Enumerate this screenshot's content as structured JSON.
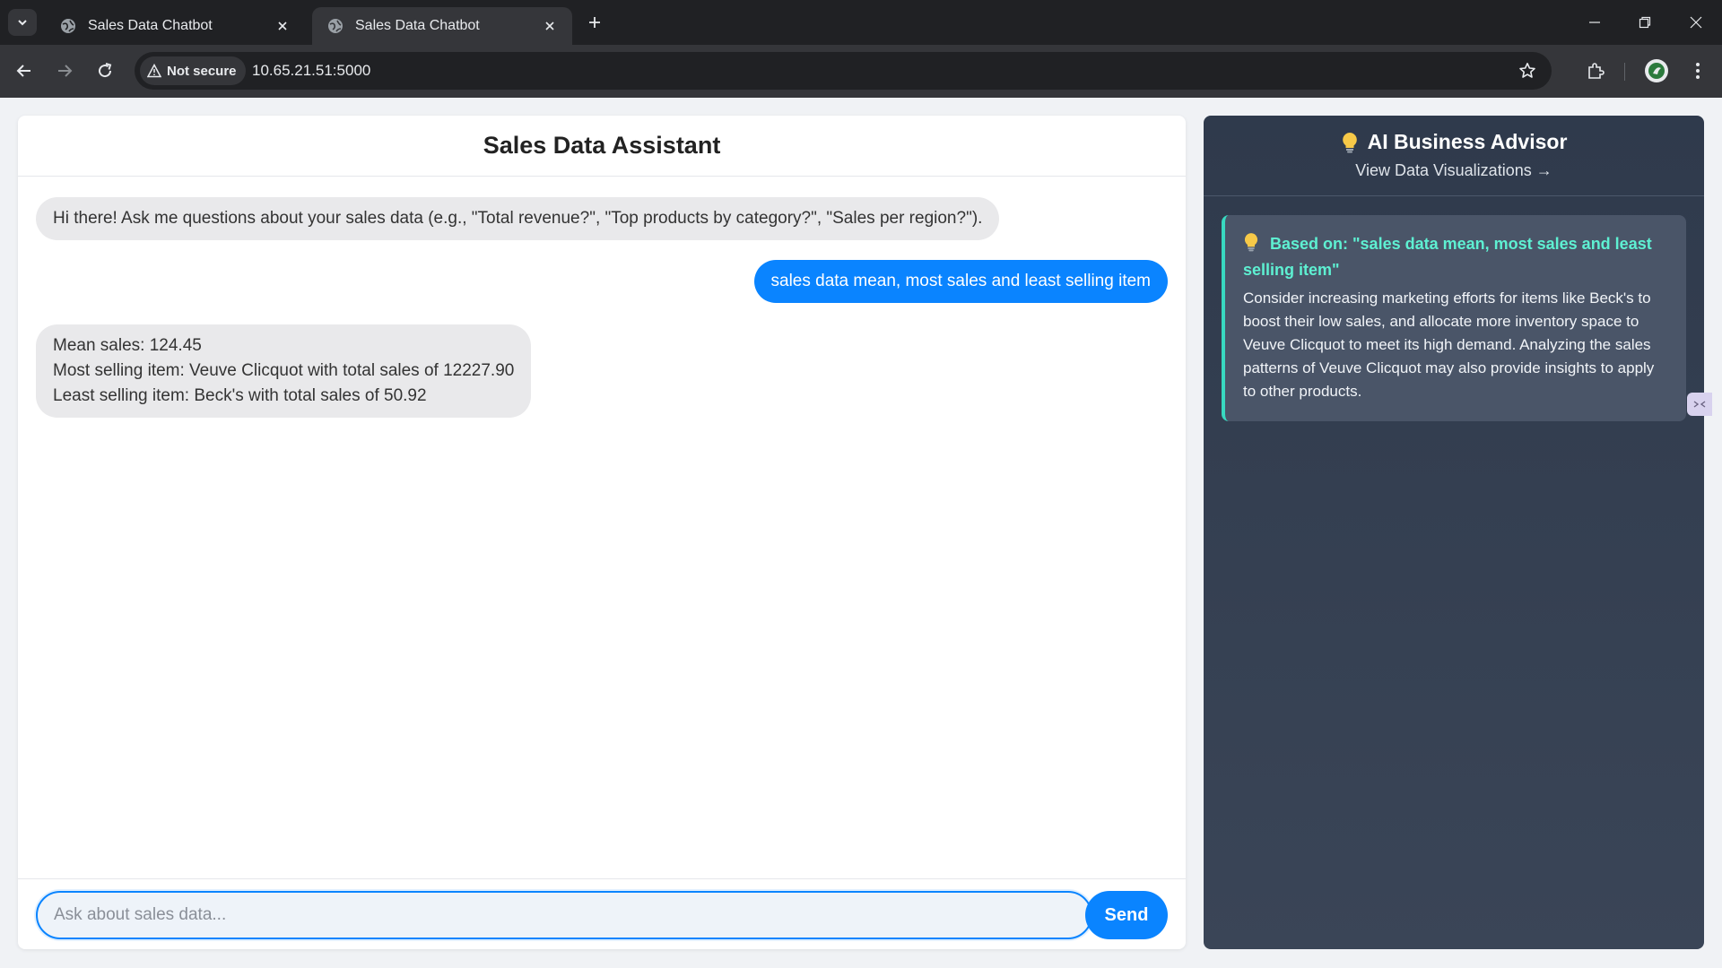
{
  "browser": {
    "tabs": [
      {
        "title": "Sales Data Chatbot",
        "active": false
      },
      {
        "title": "Sales Data Chatbot",
        "active": true
      }
    ],
    "security_label": "Not secure",
    "url": "10.65.21.51:5000"
  },
  "chat": {
    "title": "Sales Data Assistant",
    "messages": [
      {
        "role": "bot",
        "lines": [
          "Hi there! Ask me questions about your sales data (e.g., \"Total revenue?\", \"Top products by category?\", \"Sales per region?\")."
        ]
      },
      {
        "role": "user",
        "lines": [
          "sales data mean, most sales and least selling item"
        ]
      },
      {
        "role": "bot",
        "lines": [
          "Mean sales: 124.45",
          "Most selling item: Veuve Clicquot with total sales of 12227.90",
          "Least selling item: Beck's with total sales of 50.92"
        ]
      }
    ],
    "input_placeholder": "Ask about sales data...",
    "input_value": "",
    "send_label": "Send"
  },
  "advisor": {
    "title": "AI Business Advisor",
    "link_label": "View Data Visualizations →",
    "insight": {
      "heading": "Based on: \"sales data mean, most sales and least selling item\"",
      "body": "Consider increasing marketing efforts for items like Beck's to boost their low sales, and allocate more inventory space to Veuve Clicquot to meet its high demand. Analyzing the sales patterns of Veuve Clicquot may also provide insights to apply to other products."
    }
  },
  "colors": {
    "user_bubble": "#0a84ff",
    "bot_bubble": "#e9e9eb",
    "advisor_bg": "#2f3a4c",
    "insight_accent": "#38d9c0"
  },
  "icons": [
    "tab-search-icon",
    "globe-icon",
    "close-icon",
    "plus-icon",
    "minimize-icon",
    "restore-icon",
    "back-icon",
    "forward-icon",
    "reload-icon",
    "warning-icon",
    "star-icon",
    "extensions-icon",
    "profile-avatar-icon",
    "kebab-menu-icon",
    "lightbulb-icon"
  ]
}
